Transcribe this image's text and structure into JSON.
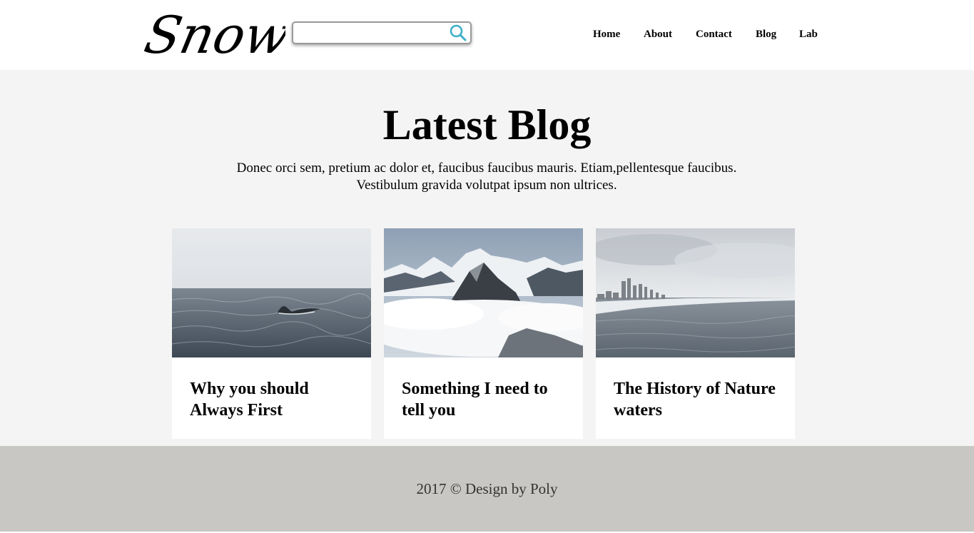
{
  "header": {
    "logo_text": "Snow",
    "search": {
      "value": "",
      "placeholder": "",
      "icon": "search-icon"
    },
    "nav": [
      "Home",
      "About",
      "Contact",
      "Blog",
      "Lab"
    ]
  },
  "main": {
    "title": "Latest Blog",
    "subtitle_line1": "Donec orci sem, pretium ac dolor et, faucibus faucibus mauris. Etiam,pellentesque faucibus.",
    "subtitle_line2": "Vestibulum gravida volutpat ipsum non ultrices.",
    "posts": [
      {
        "title": "Why you should Always First",
        "image": "whale-tail-ocean"
      },
      {
        "title": "Something I need to tell you",
        "image": "snowy-mountain-clouds"
      },
      {
        "title": "The History of Nature waters",
        "image": "city-coastline-sea"
      }
    ]
  },
  "footer": {
    "text": "2017 © Design by Poly"
  },
  "colors": {
    "accent": "#3fb0c9",
    "main_bg": "#f4f4f4",
    "footer_bg": "#c8c7c3"
  }
}
